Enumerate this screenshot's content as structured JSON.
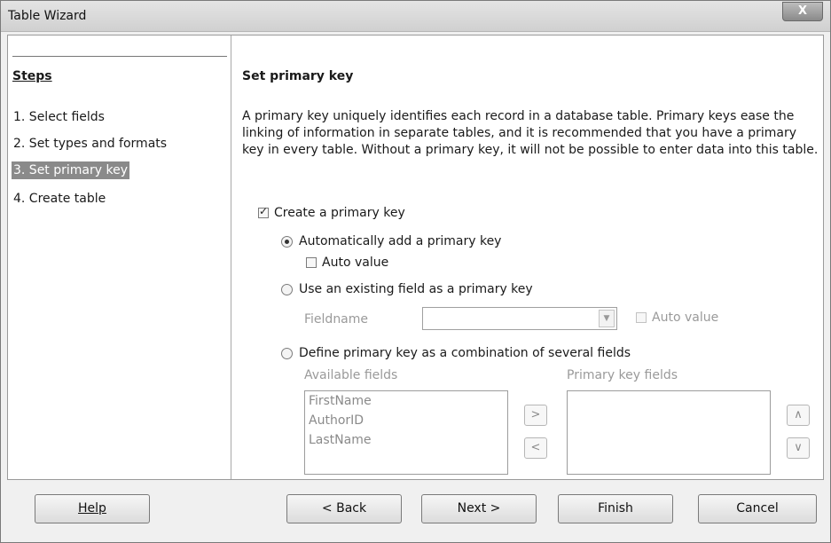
{
  "window": {
    "title": "Table Wizard",
    "close_label": "X"
  },
  "steps": {
    "heading": "Steps",
    "items": [
      {
        "label": "1. Select fields"
      },
      {
        "label": "2. Set types and formats"
      },
      {
        "label": "3. Set primary key"
      },
      {
        "label": "4. Create table"
      }
    ],
    "selected_index": 2
  },
  "main": {
    "title": "Set primary key",
    "description": "A primary key uniquely identifies each record in a database table. Primary keys ease the linking of information in separate tables, and it is recommended that you have a primary key in every table. Without a primary key, it will not be possible to enter data into this table.",
    "create_pk": {
      "label": "Create a primary key",
      "checked": true
    },
    "auto_add": {
      "label": "Automatically add a primary key",
      "selected": true
    },
    "auto_value_1": {
      "label": "Auto value",
      "checked": false
    },
    "use_existing": {
      "label": "Use an existing field as a primary key",
      "selected": false
    },
    "fieldname": {
      "label": "Fieldname",
      "value": ""
    },
    "auto_value_2": {
      "label": "Auto value",
      "checked": false
    },
    "define_combo": {
      "label": "Define primary key as a combination of several fields",
      "selected": false
    },
    "available_fields": {
      "label": "Available fields",
      "items": [
        "FirstName",
        "AuthorID",
        "LastName"
      ]
    },
    "primary_key_fields": {
      "label": "Primary key fields",
      "items": []
    },
    "move_right_label": ">",
    "move_left_label": "<",
    "move_up_label": "∧",
    "move_down_label": "∨"
  },
  "buttons": {
    "help": "Help",
    "back": "< Back",
    "next": "Next >",
    "finish": "Finish",
    "cancel": "Cancel"
  }
}
